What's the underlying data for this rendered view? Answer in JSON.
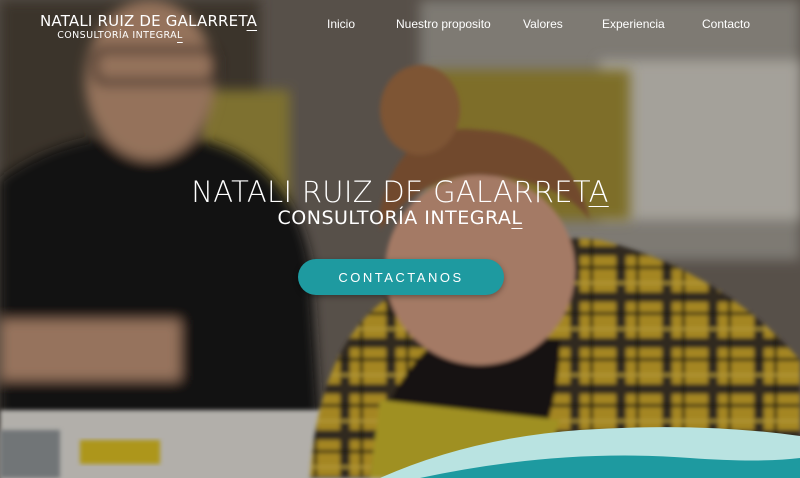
{
  "header": {
    "logo_title": "NATALI RUIZ DE GALARRET",
    "logo_title_last": "A",
    "logo_subtitle": "CONSULTORÍA INTEGRA",
    "logo_subtitle_last": "L"
  },
  "nav": {
    "items": [
      {
        "label": "Inicio"
      },
      {
        "label": "Nuestro proposito"
      },
      {
        "label": "Valores"
      },
      {
        "label": "Experiencia"
      },
      {
        "label": "Contacto"
      }
    ]
  },
  "hero": {
    "title": "NATALI RUIZ DE GALARRET",
    "title_last": "A",
    "subtitle": "CONSULTORÍA INTEGRA",
    "subtitle_last": "L",
    "cta_label": "CONTACTANOS"
  },
  "colors": {
    "accent": "#1e9aa0",
    "wave_light": "#b9e3e1",
    "wave_dark": "#1e9aa0"
  }
}
